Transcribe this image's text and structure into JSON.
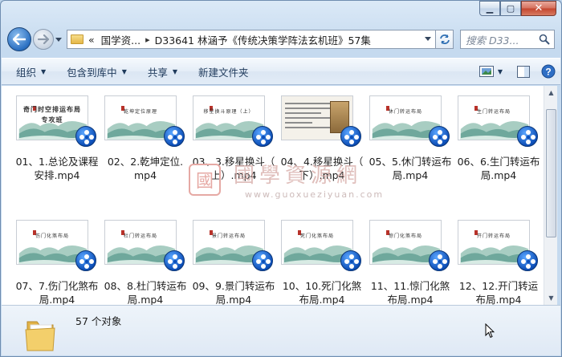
{
  "window": {
    "minimize": "▁",
    "maximize": "▢",
    "close": "✕"
  },
  "address": {
    "overflow": "«",
    "crumbs": [
      "国学资...",
      "D33641 林涵予《传统决策学阵法玄机班》57集"
    ]
  },
  "search": {
    "placeholder": "搜索 D33..."
  },
  "toolbar": {
    "organize": "组织",
    "include_library": "包含到库中",
    "share": "共享",
    "new_folder": "新建文件夹"
  },
  "files": [
    {
      "name": "01、1.总论及课程安排.mp4",
      "thumb_title": "奇门时空排运布局\n专攻班",
      "kind": "cover"
    },
    {
      "name": "02、2.乾坤定位.mp4",
      "thumb_title": "乾坤定位原理",
      "kind": "scene"
    },
    {
      "name": "03、3.移星换斗（上）.mp4",
      "thumb_title": "移星换斗原理（上）",
      "kind": "scene"
    },
    {
      "name": "04、4.移星换斗（下）.mp4",
      "thumb_title": "移星换斗原理",
      "kind": "doc"
    },
    {
      "name": "05、5.休门转运布局.mp4",
      "thumb_title": "休门转运布局",
      "kind": "scene"
    },
    {
      "name": "06、6.生门转运布局.mp4",
      "thumb_title": "生门转运布局",
      "kind": "scene"
    },
    {
      "name": "07、7.伤门化煞布局.mp4",
      "thumb_title": "伤门化煞布局",
      "kind": "scene"
    },
    {
      "name": "08、8.杜门转运布局.mp4",
      "thumb_title": "杜门转运布局",
      "kind": "scene"
    },
    {
      "name": "09、9.景门转运布局.mp4",
      "thumb_title": "景门转运布局",
      "kind": "scene"
    },
    {
      "name": "10、10.死门化煞布局.mp4",
      "thumb_title": "死门化煞布局",
      "kind": "scene"
    },
    {
      "name": "11、11.惊门化煞布局.mp4",
      "thumb_title": "惊门化煞布局",
      "kind": "scene"
    },
    {
      "name": "12、12.开门转运布局.mp4",
      "thumb_title": "开门转运布局",
      "kind": "scene"
    }
  ],
  "labels_display": [
    [
      "01、1.总论及课程",
      "安排.mp4"
    ],
    [
      "02、2.乾坤定位.",
      "mp4"
    ],
    [
      "03、3.移星换斗（",
      "上）.mp4"
    ],
    [
      "04、4.移星换斗（",
      "下）.mp4"
    ],
    [
      "05、5.休门转运布",
      "局.mp4"
    ],
    [
      "06、6.生门转运布",
      "局.mp4"
    ],
    [
      "07、7.伤门化煞布",
      "局.mp4"
    ],
    [
      "08、8.杜门转运布",
      "局.mp4"
    ],
    [
      "09、9.景门转运布",
      "局.mp4"
    ],
    [
      "10、10.死门化煞",
      "布局.mp4"
    ],
    [
      "11、11.惊门化煞",
      "布局.mp4"
    ],
    [
      "12、12.开门转运",
      "布局.mp4"
    ]
  ],
  "watermark": {
    "seal": "國",
    "text": "國學資源網",
    "url": "www.guoxueziyuan.com"
  },
  "status": {
    "count": "57 个对象"
  },
  "colors": {
    "mountain": "#6fa89c",
    "mountain_light": "#a8cdc2",
    "accent": "#2a6fc1"
  }
}
